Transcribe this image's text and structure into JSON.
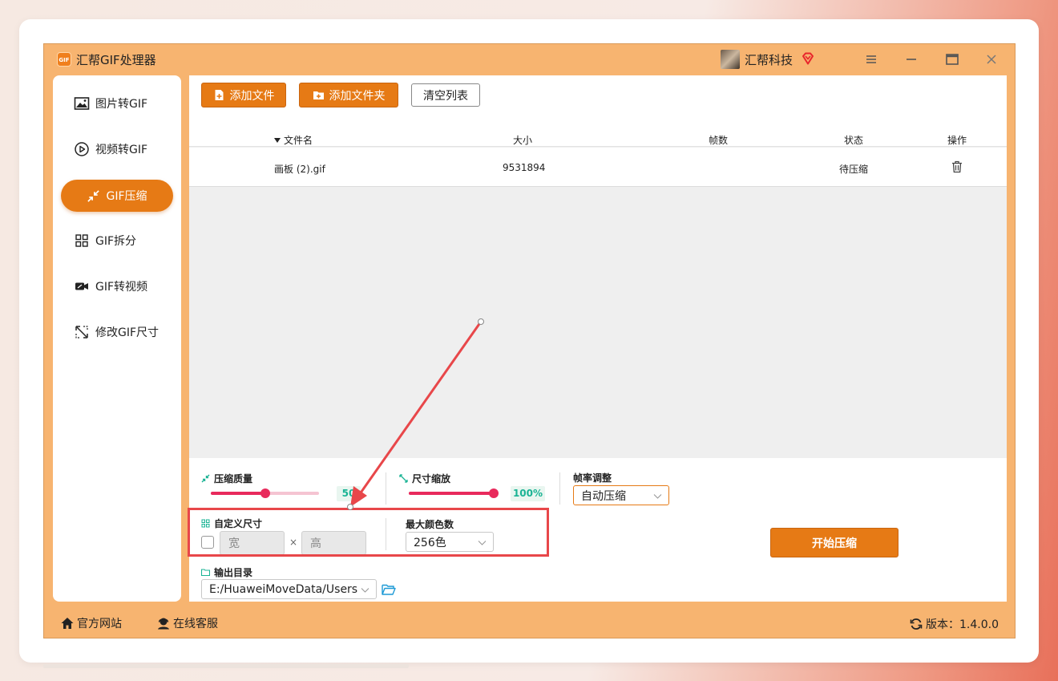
{
  "window": {
    "logo_text": "GIF",
    "app_title": "汇帮GIF处理器",
    "company": "汇帮科技"
  },
  "sidebar": {
    "items": [
      {
        "label": "图片转GIF",
        "icon": "image-icon"
      },
      {
        "label": "视频转GIF",
        "icon": "play-circle-icon"
      },
      {
        "label": "GIF压缩",
        "icon": "compress-icon",
        "active": true
      },
      {
        "label": "GIF拆分",
        "icon": "split-icon"
      },
      {
        "label": "GIF转视频",
        "icon": "video-icon"
      },
      {
        "label": "修改GIF尺寸",
        "icon": "resize-icon"
      }
    ]
  },
  "toolbar": {
    "add_file": "添加文件",
    "add_folder": "添加文件夹",
    "clear_list": "清空列表"
  },
  "table": {
    "headers": {
      "filename": "文件名",
      "size": "大小",
      "frames": "帧数",
      "status": "状态",
      "action": "操作"
    },
    "rows": [
      {
        "filename": "画板 (2).gif",
        "size": "9531894",
        "frames": "",
        "status": "待压缩"
      }
    ]
  },
  "settings": {
    "quality": {
      "label": "压缩质量",
      "value": "50",
      "fraction": 0.5
    },
    "scale": {
      "label": "尺寸缩放",
      "value": "100%",
      "fraction": 1.0
    },
    "framerate": {
      "label": "帧率调整",
      "selected": "自动压缩"
    },
    "custom_size": {
      "label": "自定义尺寸",
      "width_placeholder": "宽",
      "times": "×",
      "height_placeholder": "高"
    },
    "max_colors": {
      "label": "最大颜色数",
      "selected": "256色"
    },
    "output": {
      "label": "输出目录",
      "path": "E:/HuaweiMoveData/Users"
    },
    "start_button": "开始压缩"
  },
  "footer": {
    "website": "官方网站",
    "service": "在线客服",
    "version": "版本：1.4.0.0"
  },
  "colors": {
    "accent": "#e67a15",
    "window_bg": "#f7b470",
    "slider": "#e82a5c",
    "badge_text": "#1ab394",
    "annotation": "#e8474a"
  }
}
